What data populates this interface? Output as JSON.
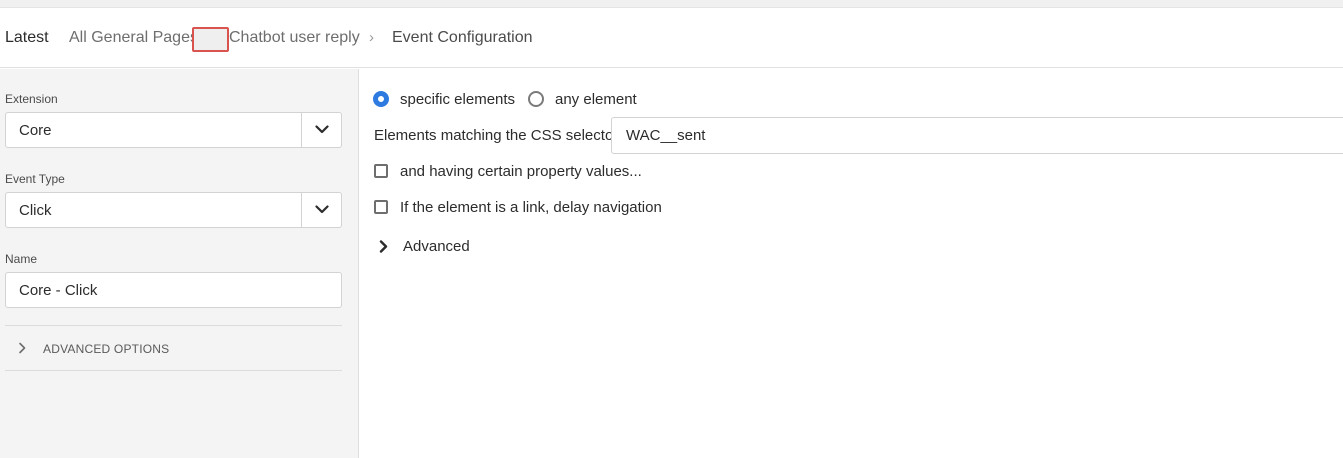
{
  "breadcrumb": {
    "items": [
      "Latest",
      "All General Pages",
      "Chatbot user reply",
      "Event Configuration"
    ],
    "separator": "›"
  },
  "sidebar": {
    "extension": {
      "label": "Extension",
      "value": "Core"
    },
    "event_type": {
      "label": "Event Type",
      "value": "Click"
    },
    "name": {
      "label": "Name",
      "value": "Core - Click"
    },
    "advanced_options_label": "ADVANCED OPTIONS"
  },
  "main": {
    "radio_options": [
      {
        "label": "specific elements",
        "checked": true
      },
      {
        "label": "any element",
        "checked": false
      }
    ],
    "css_selector": {
      "label": "Elements matching the CSS selector",
      "value": "WAC__sent"
    },
    "checkboxes": [
      {
        "label": "and having certain property values...",
        "checked": false
      },
      {
        "label": "If the element is a link, delay navigation",
        "checked": false
      }
    ],
    "advanced_label": "Advanced"
  },
  "colors": {
    "accent": "#2d7be0",
    "highlight_box": "#d9534f",
    "sidebar_bg": "#f4f4f4"
  },
  "icons": [
    "chevron-right-icon",
    "chevron-down-icon"
  ]
}
